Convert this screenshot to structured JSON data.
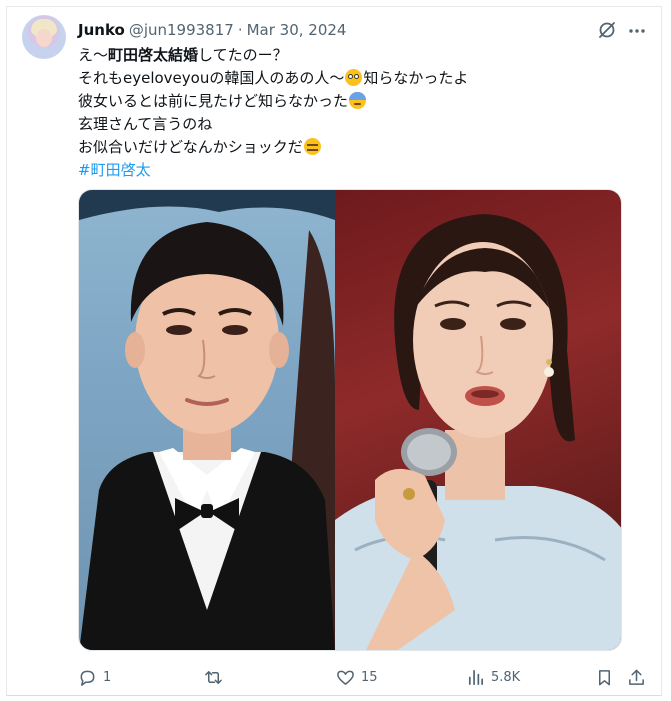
{
  "post": {
    "display_name": "Junko",
    "handle": "@jun1993817",
    "separator": "·",
    "date": "Mar 30, 2024",
    "text": {
      "line1_pre": "え〜",
      "line1_bold": "町田啓太結婚",
      "line1_post": "してたのー？",
      "line2_pre": "それもeyeloveyouの韓国人のあの人〜",
      "line2_post": "知らなかったよ",
      "line3": "彼女いるとは前に見たけど知らなかった",
      "line4": "玄理さんて言うのね",
      "line5": "お似合いだけどなんかショックだ",
      "hashtag": "#町田啓太"
    }
  },
  "icons": {
    "grok": "grok-icon",
    "more": "more-icon",
    "reply": "reply-icon",
    "repost": "repost-icon",
    "like": "heart-icon",
    "views": "views-icon",
    "bookmark": "bookmark-icon",
    "share": "share-icon"
  },
  "stats": {
    "replies": "1",
    "reposts": "",
    "likes": "15",
    "views": "5.8K"
  },
  "colors": {
    "text": "#0f1419",
    "secondary": "#536471",
    "link": "#1d9bf0"
  }
}
